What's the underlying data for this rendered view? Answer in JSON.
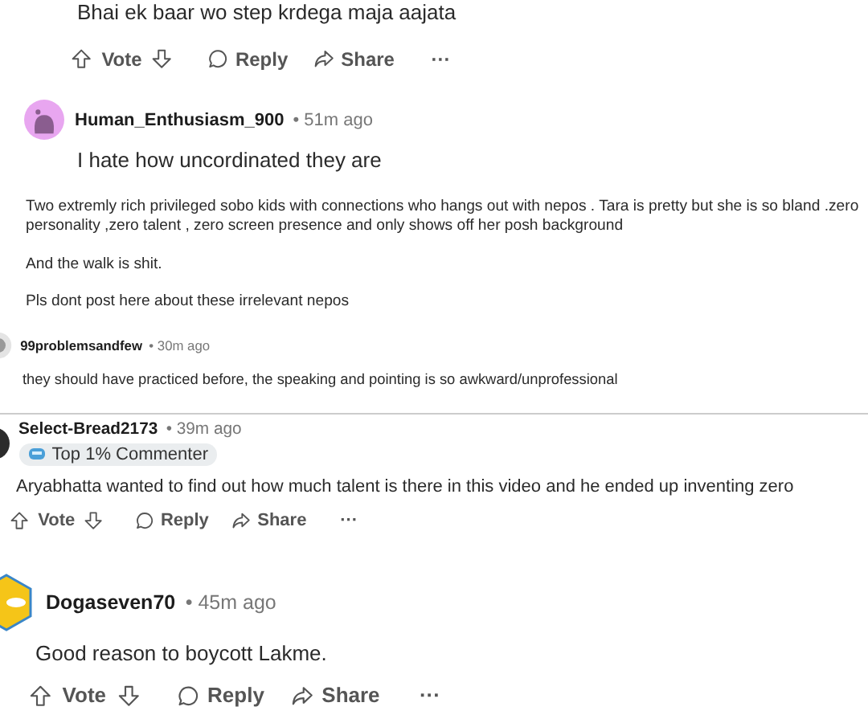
{
  "comments": [
    {
      "body": [
        "Bhai ek baar wo step krdega maja aajata"
      ],
      "actions": {
        "vote": "Vote",
        "reply": "Reply",
        "share": "Share",
        "more": "···"
      }
    },
    {
      "author": "Human_Enthusiasm_900",
      "time": "• 51m ago",
      "body": [
        "I hate how uncordinated they are"
      ]
    },
    {
      "body": [
        "Two extremly rich privileged sobo kids with connections who hangs out with nepos . Tara is pretty but she is so bland .zero personality ,zero talent , zero screen presence and only shows off her posh background",
        "And the walk is shit.",
        "Pls dont post here about these irrelevant nepos"
      ]
    },
    {
      "author": "99problemsandfew",
      "time": "• 30m ago",
      "body": [
        "they should have practiced before, the speaking and pointing is so awkward/unprofessional"
      ]
    },
    {
      "author": "Select-Bread2173",
      "time": "• 39m ago",
      "flair": "Top 1% Commenter",
      "body": [
        "Aryabhatta wanted to find out how much talent is there in this video and he ended up inventing zero"
      ],
      "actions": {
        "vote": "Vote",
        "reply": "Reply",
        "share": "Share",
        "more": "···"
      }
    },
    {
      "author": "Dogaseven70",
      "time": "• 45m ago",
      "body": [
        "Good reason to boycott Lakme."
      ],
      "actions": {
        "vote": "Vote",
        "reply": "Reply",
        "share": "Share",
        "more": "···"
      }
    }
  ]
}
